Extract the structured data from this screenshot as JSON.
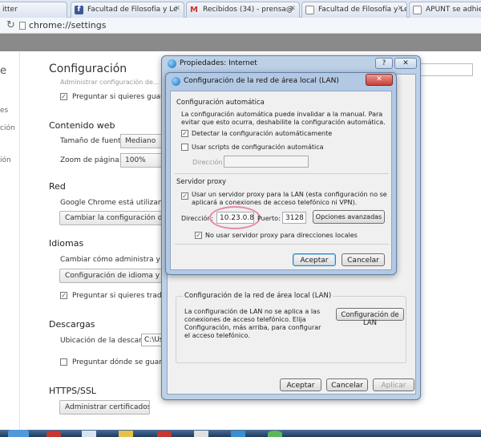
{
  "tabs": [
    {
      "label": "itter",
      "icon": "twitter-icon",
      "color": "#dfe7f1"
    },
    {
      "label": "Facultad de Filosofía y Le",
      "icon": "facebook-icon",
      "color": "#3b5998"
    },
    {
      "label": "Recibidos (34) - prensa@",
      "icon": "gmail-icon",
      "color": "#d93025"
    },
    {
      "label": "Facultad de Filosofía y Le",
      "icon": "page-icon",
      "color": "#ffffff"
    },
    {
      "label": "APUNT se adhie",
      "icon": "page-icon",
      "color": "#ffffff"
    }
  ],
  "omnibox": {
    "url": "chrome://settings"
  },
  "settings": {
    "left_cut": [
      "e",
      "es",
      "ción",
      "ión"
    ],
    "title": "Configuración",
    "faded_line": "Administrar configuración de...",
    "ask_save_passwords": "Preguntar si quieres guardar",
    "web_content": {
      "heading": "Contenido web",
      "font_size_label": "Tamaño de fuente:",
      "font_size_value": "Mediano",
      "zoom_label": "Zoom de página:",
      "zoom_value": "100%"
    },
    "network": {
      "heading": "Red",
      "text": "Google Chrome está utilizando la",
      "button": "Cambiar la configuración de pr"
    },
    "languages": {
      "heading": "Idiomas",
      "text": "Cambiar cómo administra y mue",
      "button": "Configuración de idioma y de",
      "ask_translate": "Preguntar si quieres traducir"
    },
    "downloads": {
      "heading": "Descargas",
      "location_label": "Ubicación de la descarga:",
      "location_value": "C:\\Use",
      "ask_where": "Preguntar dónde se guarda"
    },
    "https": {
      "heading": "HTTPS/SSL",
      "button": "Administrar certificados..."
    }
  },
  "internet_properties": {
    "title": "Propiedades: Internet",
    "lan_group": "Configuración de la red de área local (LAN)",
    "lan_text": "La configuración de LAN no se aplica a las conexiones de acceso telefónico. Elija Configuración, más arriba, para configurar el acceso telefónico.",
    "lan_button": "Configuración de LAN",
    "ok": "Aceptar",
    "cancel": "Cancelar",
    "apply": "Aplicar"
  },
  "lan_dialog": {
    "title": "Configuración de la red de área local (LAN)",
    "auto": {
      "heading": "Configuración automática",
      "text": "La configuración automática puede invalidar a la manual. Para evitar que esto ocurra, deshabilite la configuración automática.",
      "detect": "Detectar la configuración automáticamente",
      "use_script": "Usar scripts de configuración automática",
      "address_label": "Dirección"
    },
    "proxy": {
      "heading": "Servidor proxy",
      "use_proxy": "Usar un servidor proxy para la LAN (esta configuración no se aplicará a conexiones de acceso telefónico ni VPN).",
      "address_label": "Dirección:",
      "address_value": "10.23.0.8",
      "port_label": "Puerto:",
      "port_value": "3128",
      "advanced": "Opciones avanzadas",
      "bypass": "No usar servidor proxy para direcciones locales"
    },
    "ok": "Aceptar",
    "cancel": "Cancelar"
  },
  "colors": {
    "highlight": "#e88aa6",
    "dialog_title": "#bcd0e6",
    "close": "#c9403a"
  }
}
